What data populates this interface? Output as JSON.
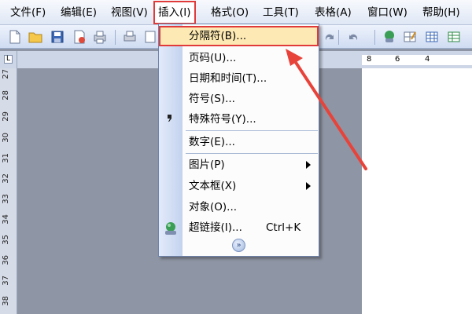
{
  "menubar": {
    "items": [
      {
        "label": "文件(F)"
      },
      {
        "label": "编辑(E)"
      },
      {
        "label": "视图(V)"
      },
      {
        "label": "插入(I)"
      },
      {
        "label": "格式(O)"
      },
      {
        "label": "工具(T)"
      },
      {
        "label": "表格(A)"
      },
      {
        "label": "窗口(W)"
      },
      {
        "label": "帮助(H)"
      }
    ]
  },
  "ruler": {
    "corner_mark": "L",
    "horizontal_labels": [
      "8",
      "6",
      "4"
    ],
    "vertical_numbers": [
      "27",
      "28",
      "29",
      "30",
      "31",
      "32",
      "33",
      "34",
      "35",
      "36",
      "37",
      "38"
    ]
  },
  "insert_menu": {
    "items": [
      {
        "label": "分隔符(B)..."
      },
      {
        "label": "页码(U)..."
      },
      {
        "label": "日期和时间(T)..."
      },
      {
        "label": "符号(S)..."
      },
      {
        "label": "特殊符号(Y)..."
      },
      {
        "label": "数字(E)..."
      },
      {
        "label": "图片(P)"
      },
      {
        "label": "文本框(X)"
      },
      {
        "label": "对象(O)..."
      },
      {
        "label": "超链接(I)...",
        "shortcut": "Ctrl+K"
      }
    ],
    "expand_glyph": "»"
  },
  "colors": {
    "highlight_border": "#e03a3a",
    "highlight_fill": "#fde9b3",
    "doc_background": "#8e95a4"
  }
}
